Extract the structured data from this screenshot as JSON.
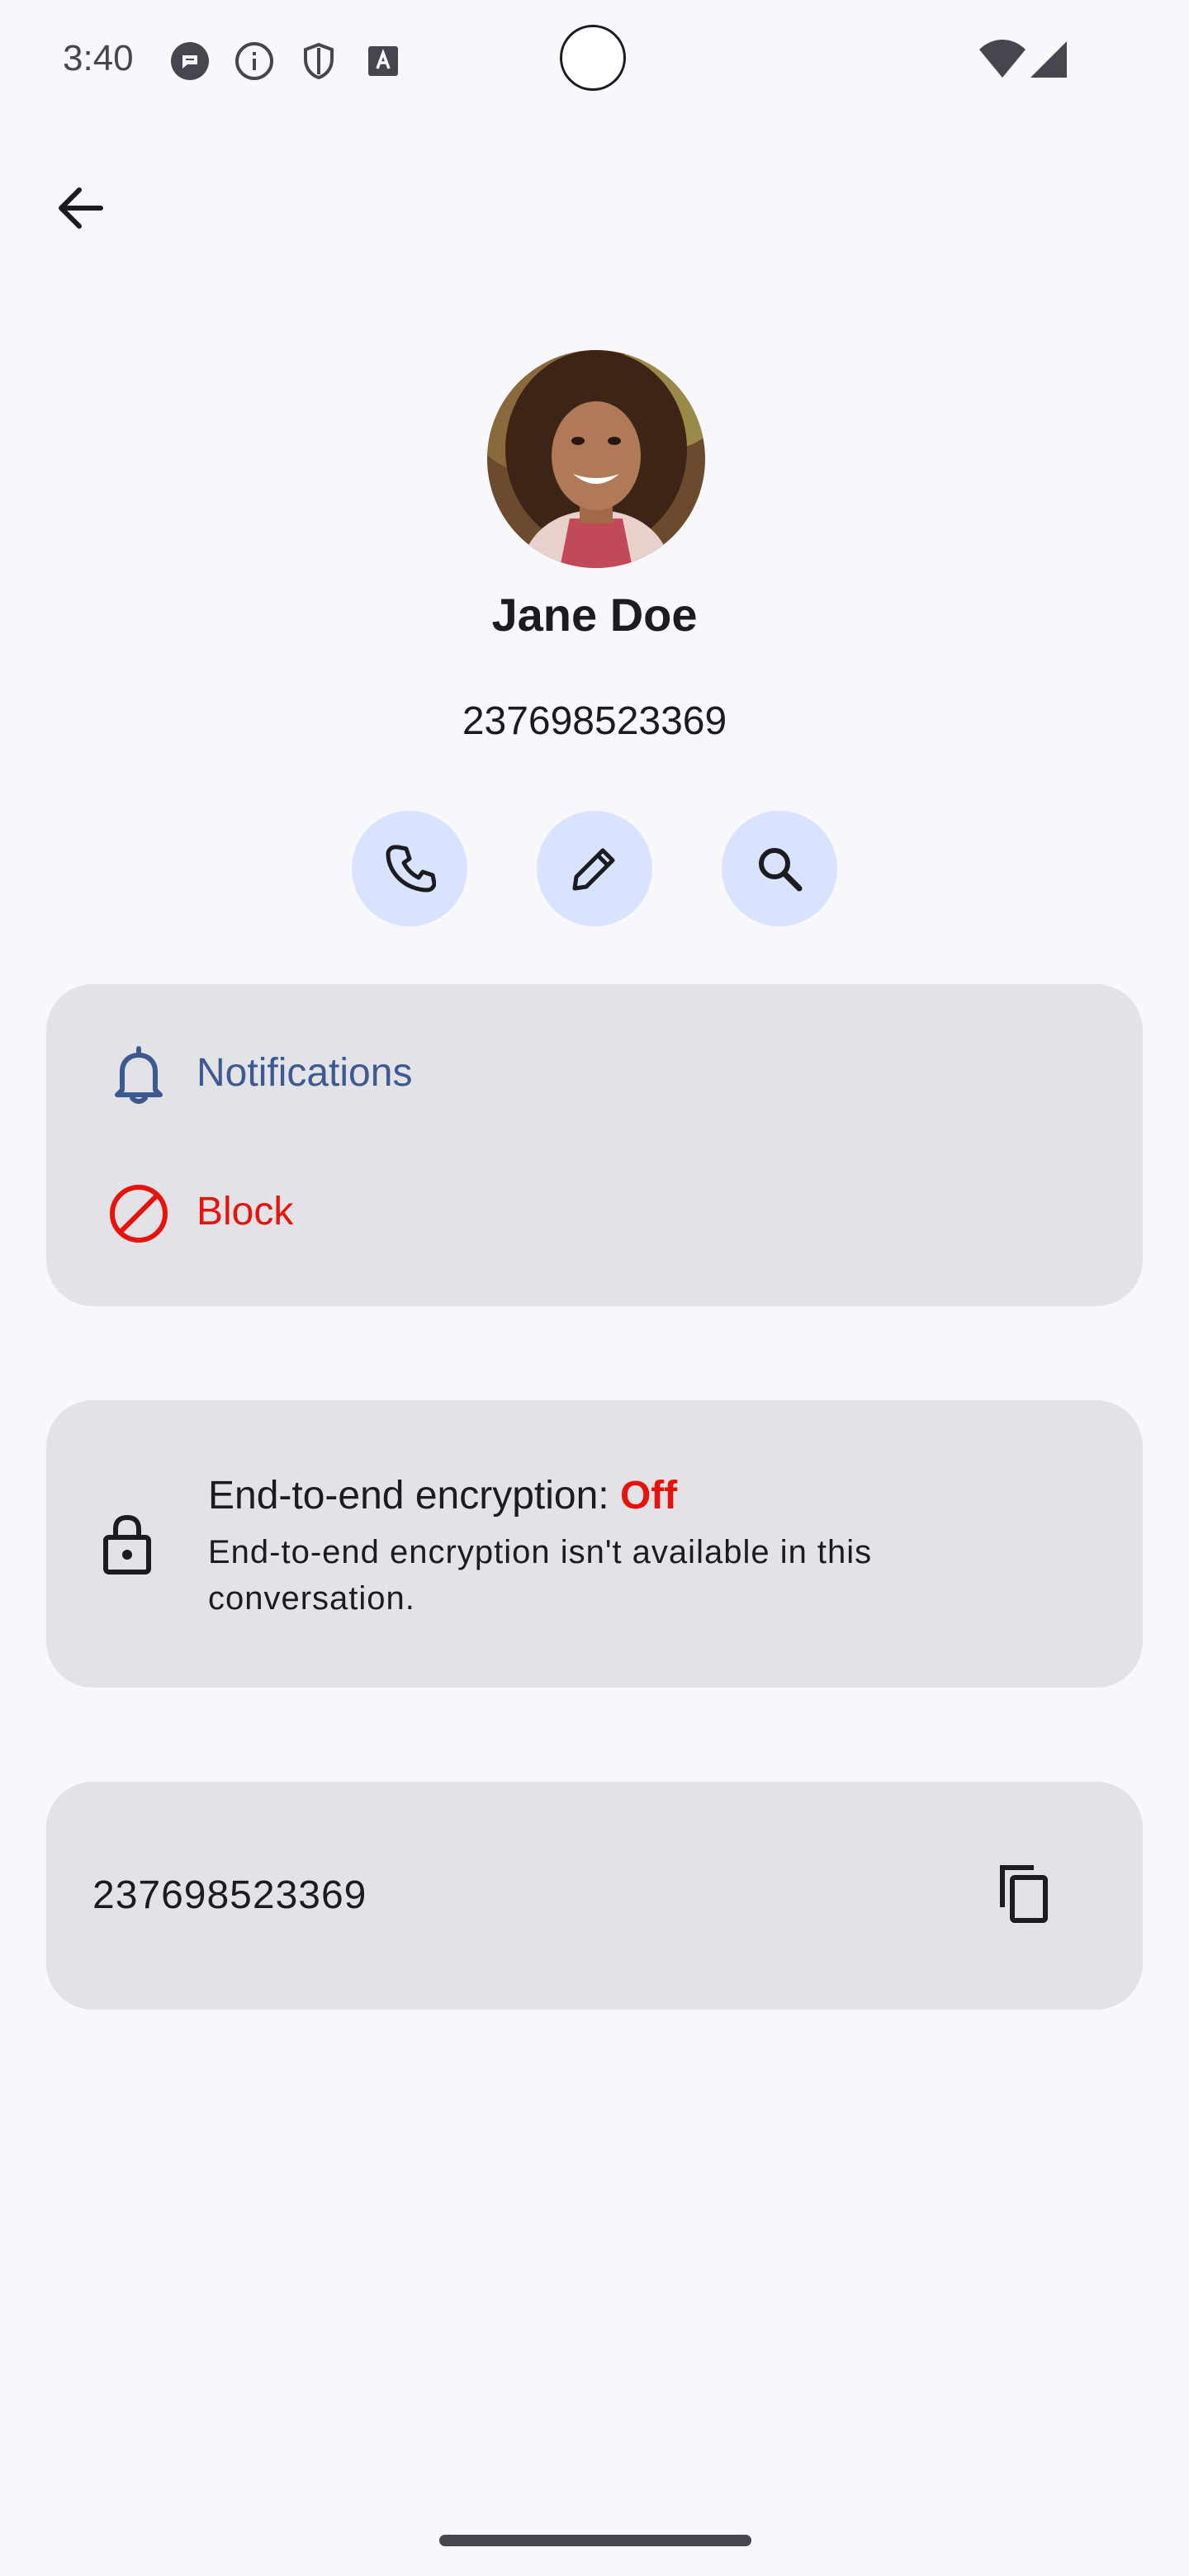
{
  "status_bar": {
    "time": "3:40",
    "icons_left": [
      "messages-icon",
      "info-icon",
      "shield-icon",
      "text-a-icon"
    ],
    "icons_right": [
      "wifi-icon",
      "signal-icon"
    ]
  },
  "toolbar": {
    "back_icon": "arrow-back-icon"
  },
  "contact": {
    "name": "Jane Doe",
    "number": "237698523369",
    "avatar": "contact-photo"
  },
  "actions": [
    {
      "icon": "phone-icon"
    },
    {
      "icon": "edit-icon"
    },
    {
      "icon": "search-icon"
    }
  ],
  "settings": {
    "notifications_label": "Notifications",
    "block_label": "Block"
  },
  "encryption": {
    "title_prefix": "End-to-end encryption: ",
    "status": "Off",
    "description": "End-to-end encryption isn't available in this conversation."
  },
  "number_card": {
    "value": "237698523369",
    "copy_icon": "copy-icon"
  },
  "colors": {
    "background": "#f8f8fc",
    "card": "#e3e2e6",
    "accent": "#3e5991",
    "danger": "#e8120c",
    "action_button": "#d9e2ff"
  }
}
